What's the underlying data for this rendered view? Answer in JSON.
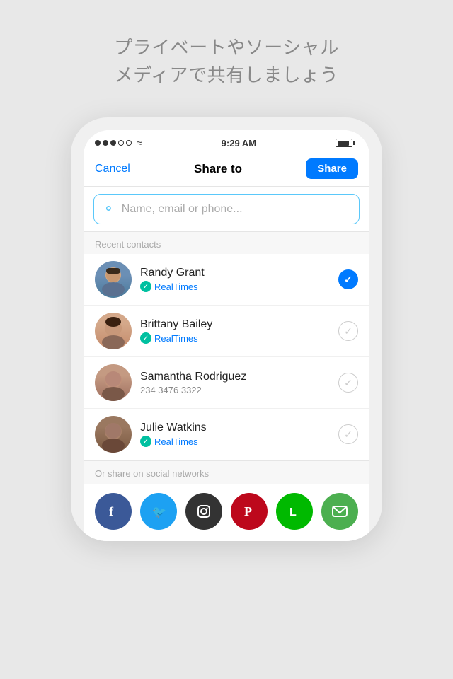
{
  "page": {
    "top_text_line1": "プライベートやソーシャル",
    "top_text_line2": "メディアで共有しましょう"
  },
  "status_bar": {
    "time": "9:29 AM",
    "dots": [
      "filled",
      "filled",
      "filled",
      "empty",
      "empty"
    ],
    "wifi": "wifi"
  },
  "nav": {
    "cancel_label": "Cancel",
    "title": "Share to",
    "share_label": "Share"
  },
  "search": {
    "placeholder": "Name, email or phone..."
  },
  "recent_contacts_label": "Recent contacts",
  "contacts": [
    {
      "name": "Randy Grant",
      "sub_type": "realtimes",
      "sub_text": "RealTimes",
      "selected": true,
      "avatar_class": "face-randy"
    },
    {
      "name": "Brittany Bailey",
      "sub_type": "realtimes",
      "sub_text": "RealTimes",
      "selected": false,
      "avatar_class": "face-brittany"
    },
    {
      "name": "Samantha Rodriguez",
      "sub_type": "phone",
      "sub_text": "234 3476 3322",
      "selected": false,
      "avatar_class": "face-samantha"
    },
    {
      "name": "Julie Watkins",
      "sub_type": "realtimes",
      "sub_text": "RealTimes",
      "selected": false,
      "avatar_class": "face-julie"
    }
  ],
  "social_label": "Or share on social networks",
  "social_buttons": [
    {
      "name": "Facebook",
      "class": "fb",
      "icon": "f",
      "id": "facebook"
    },
    {
      "name": "Twitter",
      "class": "tw",
      "icon": "🐦",
      "id": "twitter"
    },
    {
      "name": "Instagram",
      "class": "ig",
      "icon": "◎",
      "id": "instagram"
    },
    {
      "name": "Pinterest",
      "class": "pi",
      "icon": "𝖯",
      "id": "pinterest"
    },
    {
      "name": "LINE",
      "class": "line",
      "icon": "L",
      "id": "line"
    },
    {
      "name": "SMS",
      "class": "sms",
      "icon": "✉",
      "id": "sms"
    }
  ]
}
